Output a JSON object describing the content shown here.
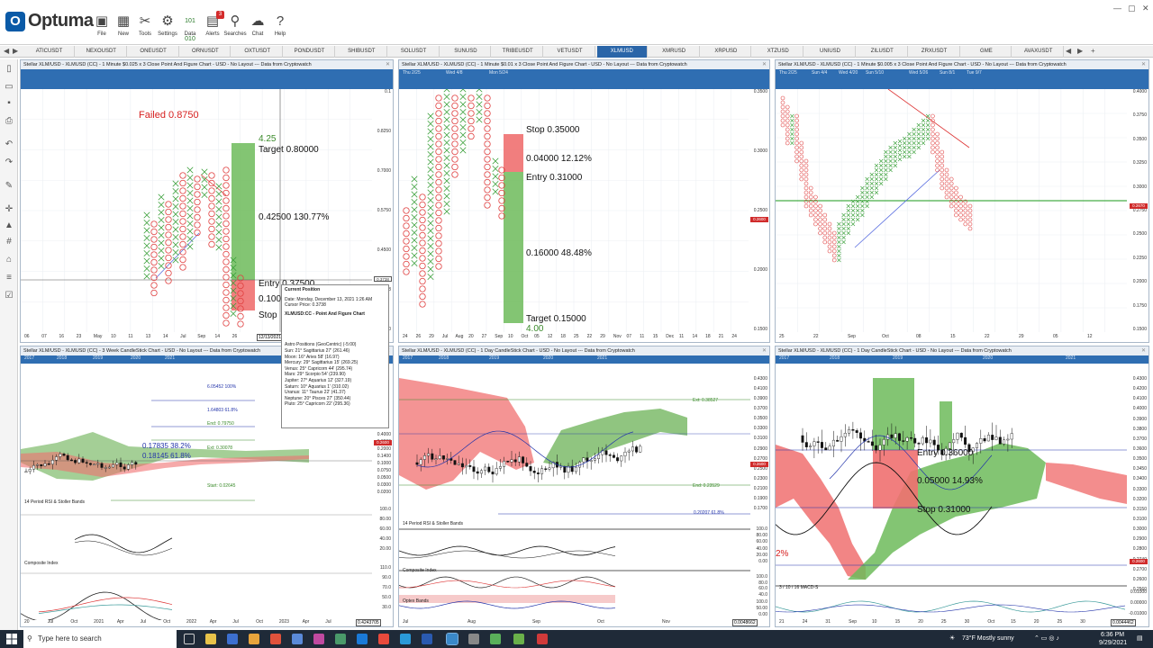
{
  "app": {
    "logo_text": "Optuma",
    "ribbon": [
      {
        "label": "File",
        "icon": "folder-icon"
      },
      {
        "label": "New",
        "icon": "new-chart-icon"
      },
      {
        "label": "Tools",
        "icon": "tools-icon"
      },
      {
        "label": "Settings",
        "icon": "gear-icon"
      },
      {
        "label": "Data",
        "icon": "data-icon"
      },
      {
        "label": "Alerts",
        "icon": "bell-icon",
        "badge": "3"
      },
      {
        "label": "Searches",
        "icon": "search-icon"
      },
      {
        "label": "Chat",
        "icon": "chat-icon"
      },
      {
        "label": "Help",
        "icon": "help-icon"
      }
    ]
  },
  "tabs": [
    "ATICUSDT",
    "NEXOUSDT",
    "ONEUSDT",
    "ORNUSDT",
    "OXTUSDT",
    "PONDUSDT",
    "SHIBUSDT",
    "SOLUSDT",
    "SUNUSD",
    "TRIBEUSDT",
    "VETUSDT",
    "XLMUSD",
    "XMRUSD",
    "XRPUSD",
    "XTZUSD",
    "UNIUSD",
    "ZILUSDT",
    "ZRXUSDT",
    "GME",
    "AVAXUSDT"
  ],
  "active_tab": "XLMUSD",
  "panels": {
    "p1": {
      "title": "Stellar XLM/USD - XLMUSD (CC) - 1 Minute $0.025 x 3 Close Point And Figure Chart - USD - No Layout --- Data from Cryptowatch",
      "y_labels": [
        "0.1",
        "0.8250",
        "0.7000",
        "0.5750",
        "0.4500",
        "0.3738",
        "0.3250"
      ],
      "x_labels": [
        "06",
        "07",
        "16",
        "23",
        "May",
        "10",
        "11",
        "13",
        "14",
        "Jul",
        "Sep",
        "14",
        "26"
      ],
      "x_box_label": "12/13/2021",
      "price_tag": "0.3738",
      "failed": "Failed 0.8750",
      "count": "4.25",
      "target": "Target   0.80000",
      "gain": "0.42500   130.77%",
      "entry": "Entry   0.37500",
      "risk": "0.100",
      "stop": "Stop"
    },
    "p2": {
      "title": "Stellar XLM/USD - XLMUSD (CC) - 1 Minute $0.01 x 3 Close Point And Figure Chart - USD - No Layout --- Data from Cryptowatch",
      "band_dates": [
        "Thu 2/25",
        "Wed 4/8",
        "Mon 5/24"
      ],
      "y_labels": [
        "0.3500",
        "0.3000",
        "0.2500",
        "0.2000",
        "0.1500"
      ],
      "price_tag": "0.2600",
      "x_labels": [
        "24",
        "26",
        "29",
        "Jul",
        "Aug",
        "20",
        "27",
        "Sep",
        "10",
        "Oct",
        "05",
        "12",
        "18",
        "25",
        "22",
        "29",
        "Nov",
        "07",
        "11",
        "15",
        "Dec",
        "11",
        "14",
        "18",
        "21",
        "24"
      ],
      "stop": "Stop   0.35000",
      "risk": "0.04000   12.12%",
      "entry": "Entry   0.31000",
      "gain": "0.16000   48.48%",
      "target": "Target   0.15000",
      "count": "4.00"
    },
    "p3": {
      "title": "Stellar XLM/USD - XLMUSD (CC) - 1 Minute $0.005 x 3 Close Point And Figure Chart - USD - No Layout --- Data from Cryptowatch",
      "band_dates": [
        "Thu 2/25",
        "Sun 4/4",
        "Wed 4/20",
        "Sun 5/10",
        "Wed 5/26",
        "Sun 8/1",
        "Tue 9/7"
      ],
      "y_labels": [
        "0.4000",
        "0.3750",
        "0.3500",
        "0.3250",
        "0.3000",
        "0.2750",
        "0.2500",
        "0.2250",
        "0.2000",
        "0.1750",
        "0.1500"
      ],
      "price_tag": "0.2670",
      "x_labels": [
        "25",
        "22",
        "Sep",
        "Oct",
        "08",
        "15",
        "22",
        "29",
        "05",
        "12"
      ]
    },
    "p4": {
      "title": "Stellar XLM/USD - XLMUSD (CC) - 3 Week CandleStick Chart - USD - No Layout --- Data from Cryptowatch",
      "years": [
        "2017",
        "2018",
        "2019",
        "2020",
        "2021"
      ],
      "fib": [
        {
          "text": "6.05452   100%",
          "color": "#2233aa"
        },
        {
          "text": "1.64803   61.8%",
          "color": "#2233aa"
        },
        {
          "text": "End: 0.79750",
          "color": "#3a8a2a"
        },
        {
          "text": "Ext: 0.30078",
          "color": "#3a8a2a"
        },
        {
          "text": "Start: 0.02645",
          "color": "#3a8a2a"
        }
      ],
      "box_labels": [
        "0.17835   38.2%",
        "0.18145   61.8%"
      ],
      "y_labels": [
        "0.4000",
        "0.3000",
        "0.2000",
        "0.1400",
        "0.1000",
        "0.0750",
        "0.0500",
        "0.0300",
        "0.0200"
      ],
      "price_tag": "0.2600",
      "rsi_title": "14 Period RSI & Stoller Bands",
      "rsi_labels": [
        "100.0",
        "80.00",
        "60.00",
        "40.00",
        "20.00"
      ],
      "comp_title": "Composite Index",
      "comp_labels": [
        "110.0",
        "90.0",
        "70.0",
        "50.0",
        "30.0"
      ],
      "x_labels": [
        "20",
        "Jul",
        "Oct",
        "2021",
        "Apr",
        "Jul",
        "Oct",
        "2022",
        "Apr",
        "Jul",
        "Oct",
        "2023",
        "Apr",
        "Jul"
      ],
      "x_box_label": "0.4243705"
    },
    "p5": {
      "title": "Stellar XLM/USD - XLMUSD (CC) - 1 Day CandleStick Chart - USD - No Layout --- Data from Cryptowatch",
      "years": [
        "2017",
        "2018",
        "2019",
        "2020",
        "2021"
      ],
      "ext": "Ext: 0.38527",
      "end": "End: 0.23529",
      "fib": "0.20207   61.8%",
      "y_labels": [
        "0.4300",
        "0.4100",
        "0.3900",
        "0.3700",
        "0.3500",
        "0.3300",
        "0.3100",
        "0.2900",
        "0.2700",
        "0.2500",
        "0.2300",
        "0.2100",
        "0.1900",
        "0.1700"
      ],
      "price_tag": "0.2600",
      "rsi_title": "14 Period RSI & Stoller Bands",
      "rsi_labels": [
        "100.0",
        "80.00",
        "60.00",
        "40.00",
        "20.00",
        "0.00"
      ],
      "comp_title": "Composite Index",
      "comp_labels": [
        "100.0",
        "80.0",
        "60.0",
        "40.0"
      ],
      "optex_title": "Optex Bands",
      "optex_labels": [
        "100.0",
        "50.00",
        "0.00"
      ],
      "x_labels": [
        "Jul",
        "Aug",
        "Sep",
        "Oct",
        "Nov"
      ],
      "x_box_label": "0.0048662"
    },
    "p6": {
      "title": "Stellar XLM/USD - XLMUSD (CC) - 1 Day CandleStick Chart - USD - No Layout --- Data from Cryptowatch",
      "years": [
        "2017",
        "2018",
        "2019",
        "2020",
        "2021"
      ],
      "entry": "Entry   0.36000",
      "risk": "0.05000   14.93%",
      "stop": "Stop   0.31000",
      "left_pct": "2%",
      "y_labels": [
        "0.4300",
        "0.4200",
        "0.4100",
        "0.4000",
        "0.3900",
        "0.3800",
        "0.3700",
        "0.3600",
        "0.3500",
        "0.3450",
        "0.3400",
        "0.3300",
        "0.3200",
        "0.3150",
        "0.3100",
        "0.3000",
        "0.2900",
        "0.2800",
        "0.2740",
        "0.2700",
        "0.2600",
        "0.2560"
      ],
      "price_tag": "0.2600",
      "macd_title": "3 / 10 / 16 MACD-S",
      "macd_labels": [
        "0.01000",
        "0.00000",
        "-0.01000"
      ],
      "x_labels": [
        "21",
        "24",
        "31",
        "Sep",
        "10",
        "15",
        "20",
        "25",
        "30",
        "Oct",
        "15",
        "20",
        "25",
        "30"
      ],
      "x_box_label": "0.0044462"
    }
  },
  "tooltip": {
    "title": "Current Position",
    "date": "Date: Monday, December 13, 2021 1:26 AM",
    "cursor": "Cursor Price: 0.3738",
    "chart": "XLMUSD:CC - Point And Figure Chart",
    "astro_title": "Astro Positions (GeoCentric) (-5:00)",
    "astro": [
      "Sun: 21° Sagittarius 27' (261.46)",
      "Moon: 16° Aries 58' (16.97)",
      "Mercury: 29° Sagittarius 15' (269.25)",
      "Venus: 25° Capricorn 44' (295.74)",
      "Mars: 29° Scorpio 54' (239.90)",
      "Jupiter: 27° Aquarius 12' (327.19)",
      "Saturn: 10° Aquarius 1' (310.02)",
      "Uranus: 11° Taurus 22' (41.37)",
      "Neptune: 20° Pisces 27' (350.44)",
      "Pluto: 25° Capricorn 22' (295.36)"
    ]
  },
  "taskbar": {
    "search_placeholder": "Type here to search",
    "weather": "73°F  Mostly sunny",
    "time": "6:36 PM",
    "date": "9/29/2021"
  },
  "colors": {
    "accent": "#2a65a8",
    "band": "#2f6eb2",
    "up": "#5aa84a",
    "down": "#e84a4a",
    "taskbar": "#1f2a38"
  }
}
